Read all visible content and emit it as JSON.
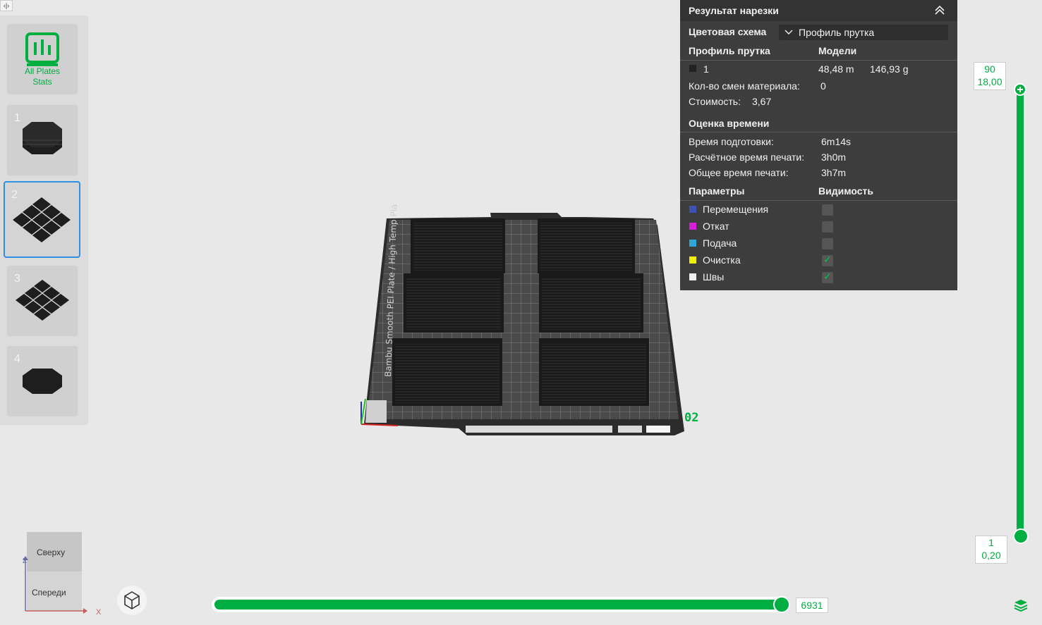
{
  "plates": {
    "stats_label_line1": "All Plates",
    "stats_label_line2": "Stats",
    "items": [
      {
        "num": "1",
        "icon": "octagon-stack-icon"
      },
      {
        "num": "2",
        "icon": "diamond-tiles-icon",
        "selected": true
      },
      {
        "num": "3",
        "icon": "diamond-tiles-icon"
      },
      {
        "num": "4",
        "icon": "octagon-icon"
      }
    ]
  },
  "scene": {
    "plate_name": "02",
    "bed_label": "Bambu Smooth PEI Plate / High Temp Plate"
  },
  "panel": {
    "title": "Результат нарезки",
    "color_scheme_label": "Цветовая схема",
    "color_scheme_value": "Профиль прутка",
    "col_filament": "Профиль прутка",
    "col_models": "Модели",
    "filament_id": "1",
    "filament_length": "48,48 m",
    "filament_weight": "146,93 g",
    "changes_label": "Кол-во смен материала:",
    "changes_value": "0",
    "cost_label": "Стоимость:",
    "cost_value": "3,67",
    "time_section": "Оценка времени",
    "prep_label": "Время подготовки:",
    "prep_value": "6m14s",
    "calc_label": "Расчётное время печати:",
    "calc_value": "3h0m",
    "total_label": "Общее время печати:",
    "total_value": "3h7m",
    "params_label": "Параметры",
    "visibility_label": "Видимость",
    "params": [
      {
        "name": "Перемещения",
        "color": "#3f51b5",
        "visible": false
      },
      {
        "name": "Откат",
        "color": "#d81ed8",
        "visible": false
      },
      {
        "name": "Подача",
        "color": "#2ea8d8",
        "visible": false
      },
      {
        "name": "Очистка",
        "color": "#f0f000",
        "visible": true
      },
      {
        "name": "Швы",
        "color": "#f0f0f0",
        "visible": true
      }
    ]
  },
  "layer_slider": {
    "top_layer": "90",
    "top_height": "18,00",
    "bottom_layer": "1",
    "bottom_height": "0,20"
  },
  "move_slider": {
    "value": "6931"
  },
  "view_cube": {
    "top": "Сверху",
    "front": "Спереди",
    "axis_z": "Z",
    "axis_x": "X"
  },
  "colors": {
    "accent": "#00ae42",
    "panel_bg": "#3d3d3d",
    "selection": "#2f8fe0"
  }
}
